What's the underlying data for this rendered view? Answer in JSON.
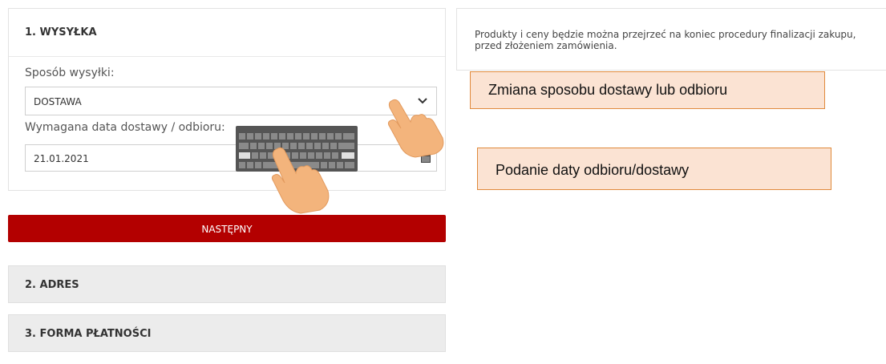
{
  "shipping": {
    "title": "1. WYSYŁKA",
    "method_label": "Sposób wysyłki:",
    "method_value": "DOSTAWA",
    "date_label": "Wymagana data dostawy / odbioru:",
    "date_value": "21.01.2021"
  },
  "next_button": "NASTĘPNY",
  "steps": [
    {
      "label": "2. ADRES"
    },
    {
      "label": "3. FORMA PŁATNOŚCI"
    }
  ],
  "info": {
    "text": "Produkty i ceny będzie można przejrzeć na koniec procedury finalizacji zakupu, przed złożeniem zamówienia."
  },
  "callouts": [
    {
      "text": "Zmiana sposobu dostawy lub odbioru"
    },
    {
      "text": "Podanie daty odbioru/dostawy"
    }
  ],
  "colors": {
    "accent": "#b30000",
    "callout_bg": "#fbe3d3",
    "callout_border": "#e08a3c",
    "step_bg": "#ececec"
  },
  "icons": {
    "select_chevron": "chevron-down-icon",
    "date_picker": "calendar-icon",
    "hand": "tap-hand-icon",
    "keyboard": "keyboard-icon"
  }
}
